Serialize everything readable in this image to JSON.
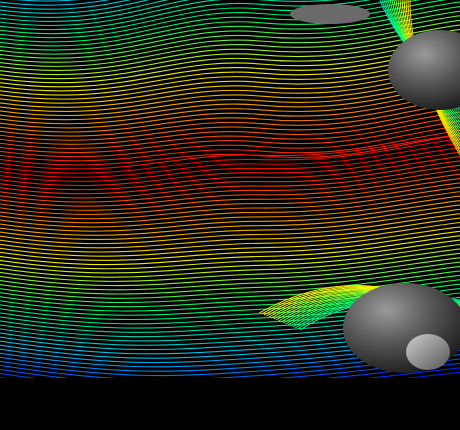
{
  "scene": {
    "subject": "streamline-visualization",
    "background_color": "#000000",
    "wheel_color": "#4a4a4a",
    "colormap": [
      "#0000ff",
      "#00c8ff",
      "#00ff66",
      "#ffff00",
      "#ff8000",
      "#ff0000"
    ]
  }
}
